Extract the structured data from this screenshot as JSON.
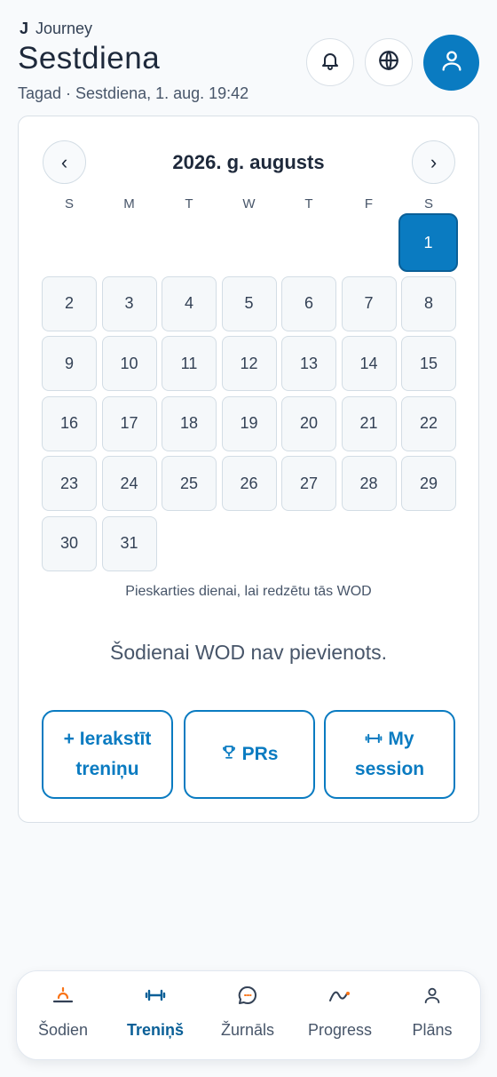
{
  "header": {
    "brand_logo": "J",
    "brand_name": "Journey",
    "title": "Sestdiena",
    "subtitle": "Tagad · Sestdiena, 1. aug. 19:42",
    "buttons": [
      "bell-icon",
      "globe-icon",
      "user-icon"
    ]
  },
  "calendar": {
    "month_title": "2026. g. augusts",
    "prev_label": "‹",
    "next_label": "›",
    "weekdays": [
      "S",
      "M",
      "T",
      "W",
      "T",
      "F",
      "S"
    ],
    "days": [
      "1",
      "2",
      "3",
      "4",
      "5",
      "6",
      "7",
      "8",
      "9",
      "10",
      "11",
      "12",
      "13",
      "14",
      "15",
      "16",
      "17",
      "18",
      "19",
      "20",
      "21",
      "22",
      "23",
      "24",
      "25",
      "26",
      "27",
      "28",
      "29",
      "30",
      "31"
    ],
    "selected_day": "1",
    "hint": "Pieskarties dienai, lai redzētu tās WOD",
    "empty_message": "Šodienai WOD nav pievienots."
  },
  "actions": {
    "log_workout": {
      "line1": "+ Ierakstīt",
      "line2": "treniņu"
    },
    "prs": {
      "label": "PRs",
      "icon": "trophy-icon"
    },
    "session": {
      "line1": "My",
      "line2": "session",
      "icon": "dumbbell-icon"
    }
  },
  "nav": {
    "items": [
      {
        "label": "Šodien",
        "icon": "sunrise-icon"
      },
      {
        "label": "Treniņš",
        "icon": "dumbbell-icon"
      },
      {
        "label": "Žurnāls",
        "icon": "chat-bubble-icon"
      },
      {
        "label": "Progress",
        "icon": "trend-line-icon"
      },
      {
        "label": "Plāns",
        "icon": "user-icon"
      }
    ],
    "active": "Treniņš"
  },
  "colors": {
    "accent": "#0a7bc1",
    "accent_dark": "#0a5f97",
    "background": "#f8fafc",
    "text": "#1e293b",
    "muted": "#475569"
  }
}
